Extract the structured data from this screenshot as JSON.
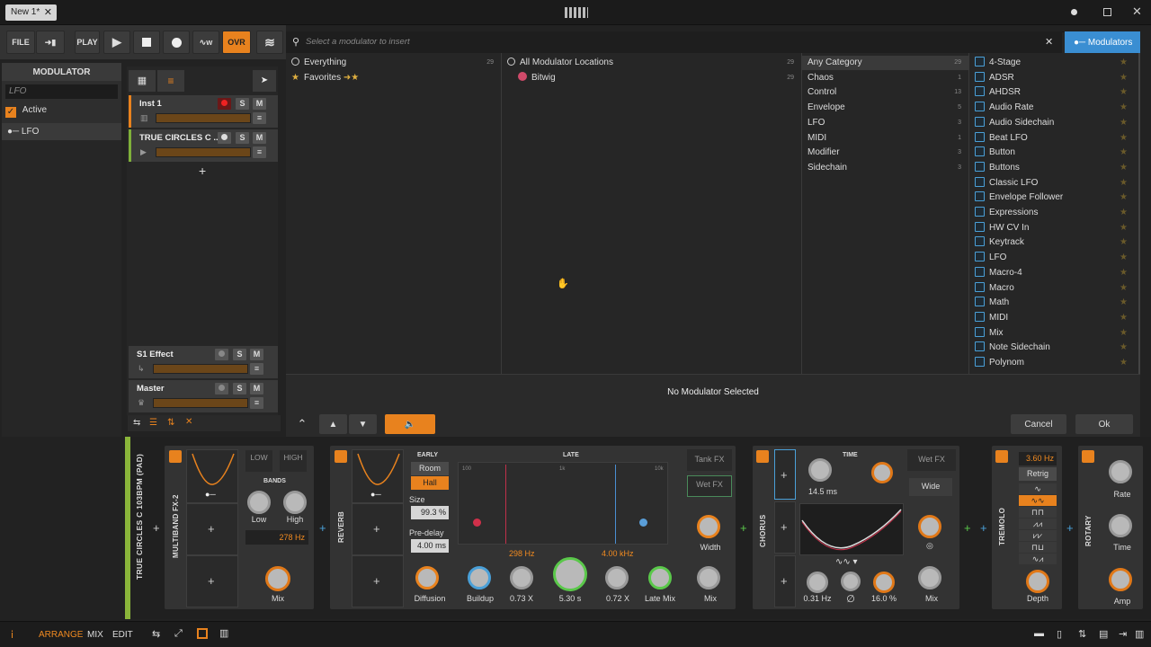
{
  "window": {
    "tab_title": "New 1*",
    "tab_close": "✕"
  },
  "toolbar": {
    "file": "FILE",
    "play_label": "PLAY",
    "ovr": "OVR"
  },
  "inspector": {
    "header": "MODULATOR",
    "name_value": "LFO",
    "active_label": "Active",
    "lfo_label": "LFO"
  },
  "tracks": [
    {
      "name": "Inst 1",
      "s": "S",
      "m": "M"
    },
    {
      "name": "TRUE CIRCLES C ...",
      "s": "S",
      "m": "M"
    },
    {
      "name": "S1 Effect",
      "s": "S",
      "m": "M"
    },
    {
      "name": "Master",
      "s": "S",
      "m": "M"
    }
  ],
  "popup": {
    "search_placeholder": "Select a modulator to insert",
    "modulators_tab": "Modulators",
    "col1": [
      {
        "label": "Everything",
        "count": "29"
      },
      {
        "label": "Favorites",
        "count": ""
      }
    ],
    "col2": [
      {
        "label": "All Modulator Locations",
        "count": "29"
      },
      {
        "label": "Bitwig",
        "count": "29"
      }
    ],
    "col3": [
      {
        "label": "Any Category",
        "count": "29"
      },
      {
        "label": "Chaos",
        "count": "1"
      },
      {
        "label": "Control",
        "count": "13"
      },
      {
        "label": "Envelope",
        "count": "5"
      },
      {
        "label": "LFO",
        "count": "3"
      },
      {
        "label": "MIDI",
        "count": "1"
      },
      {
        "label": "Modifier",
        "count": "3"
      },
      {
        "label": "Sidechain",
        "count": "3"
      }
    ],
    "col4": [
      "4-Stage",
      "ADSR",
      "AHDSR",
      "Audio Rate",
      "Audio Sidechain",
      "Beat LFO",
      "Button",
      "Buttons",
      "Classic LFO",
      "Envelope Follower",
      "Expressions",
      "HW CV In",
      "Keytrack",
      "LFO",
      "Macro-4",
      "Macro",
      "Math",
      "MIDI",
      "Mix",
      "Note Sidechain",
      "Polynom"
    ],
    "status": "No Modulator Selected",
    "cancel": "Cancel",
    "ok": "Ok"
  },
  "devices": {
    "track_label": "TRUE CIRCLES C 103BPM (PAD)",
    "multiband": {
      "title": "MULTIBAND FX-2",
      "low_tab": "LOW",
      "high_tab": "HIGH",
      "bands": "BANDS",
      "low": "Low",
      "high": "High",
      "freq": "278 Hz",
      "mix": "Mix"
    },
    "reverb": {
      "title": "REVERB",
      "early": "EARLY",
      "room": "Room",
      "hall": "Hall",
      "late": "LATE",
      "size_label": "Size",
      "size_val": "99.3 %",
      "predelay_label": "Pre-delay",
      "predelay_val": "4.00 ms",
      "freq_lo": "298 Hz",
      "freq_hi": "4.00 kHz",
      "tank": "Tank FX",
      "wetfx": "Wet FX",
      "width": "Width",
      "diffusion": "Diffusion",
      "buildup": "Buildup",
      "x1": "0.73 X",
      "time": "5.30 s",
      "x2": "0.72 X",
      "latemix": "Late Mix",
      "mix": "Mix",
      "axis_100": "100",
      "axis_1k": "1k",
      "axis_10k": "10k"
    },
    "chorus": {
      "title": "CHORUS",
      "time": "TIME",
      "time_val": "14.5 ms",
      "wetfx": "Wet FX",
      "wide": "Wide",
      "rate": "0.31 Hz",
      "phase": "∅",
      "depth": "16.0 %",
      "mix": "Mix"
    },
    "tremolo": {
      "title": "TREMOLO",
      "rate": "3.60 Hz",
      "retrig": "Retrig",
      "depth": "Depth"
    },
    "rotary": {
      "title": "ROTARY",
      "rate": "Rate",
      "time": "Time",
      "amp": "Amp"
    }
  },
  "bottombar": {
    "arrange": "ARRANGE",
    "mix": "MIX",
    "edit": "EDIT"
  }
}
